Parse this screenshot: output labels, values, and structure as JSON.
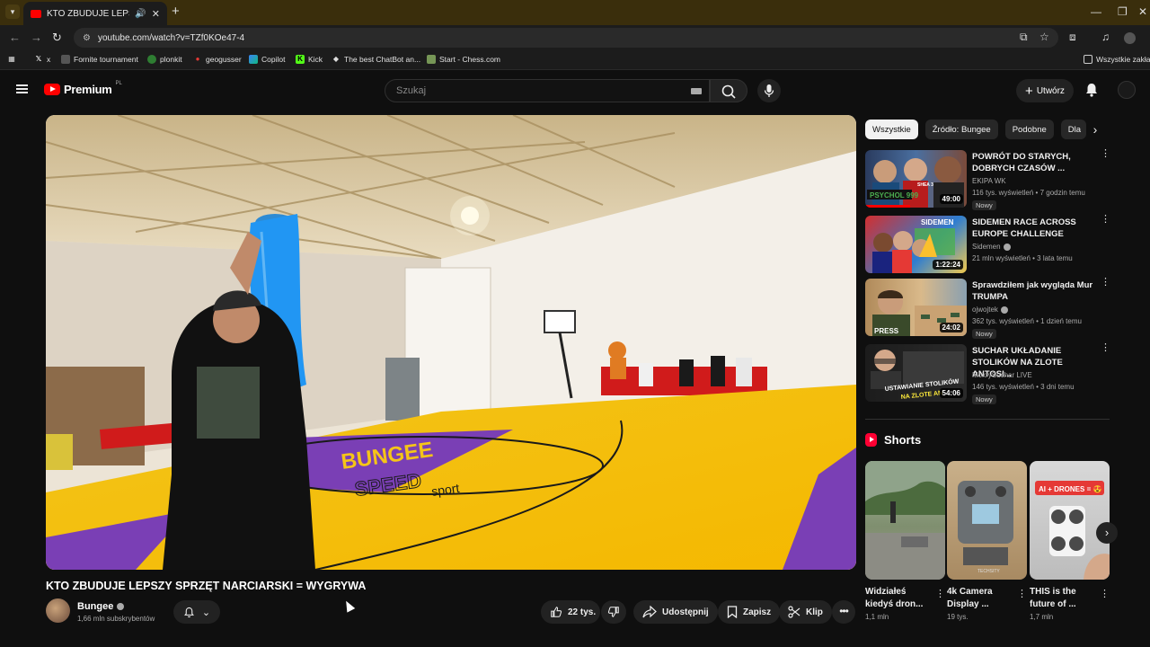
{
  "browser": {
    "tab_title": "KTO ZBUDUJE LEPSZY SPRZ",
    "url": "youtube.com/watch?v=TZf0KOe47-4",
    "bookmarks": [
      "x",
      "Fornite tournament",
      "plonkit",
      "geogusser",
      "Copilot",
      "Kick",
      "The best ChatBot an...",
      "Start - Chess.com"
    ],
    "all_bookmarks": "Wszystkie zakład"
  },
  "masthead": {
    "logo_text": "Premium",
    "country": "PL",
    "search_placeholder": "Szukaj",
    "create_label": "Utwórz"
  },
  "video": {
    "title": "KTO ZBUDUJE LEPSZY SPRZĘT NARCIARSKI = WYGRYWA",
    "channel": "Bungee",
    "subscribers": "1,66 mln subskrybentów",
    "likes": "22 tys.",
    "share_label": "Udostępnij",
    "save_label": "Zapisz",
    "clip_label": "Klip",
    "court_text_1": "BUNGEE",
    "court_text_2": "SPEED",
    "court_text_3": "sport"
  },
  "sidebar": {
    "chips": [
      "Wszystkie",
      "Źródło: Bungee",
      "Podobne",
      "Dla"
    ],
    "recommendations": [
      {
        "title": "POWRÓT DO STARYCH, DOBRYCH CZASÓW ...",
        "channel": "EKIPA WK",
        "meta": "116 tys. wyświetleń • 7 godzin temu",
        "badge": "Nowy",
        "duration": "49:00",
        "thumb_text": "PSYCHOL 999",
        "thumb_text2": "SHEA 3"
      },
      {
        "title": "SIDEMEN RACE ACROSS EUROPE CHALLENGE",
        "channel": "Sidemen",
        "meta": "21 mln wyświetleń • 3 lata temu",
        "badge": "",
        "duration": "1:22:24",
        "thumb_text": "SIDEMEN"
      },
      {
        "title": "Sprawdziłem jak wygląda Mur TRUMPA",
        "channel": "ojwojtek",
        "meta": "362 tys. wyświetleń • 1 dzień temu",
        "badge": "Nowy",
        "duration": "24:02",
        "thumb_text": "PRESS"
      },
      {
        "title": "SUCHAR UKŁADANIE STOLIKÓW NA ZLOTE ANTOSI...",
        "channel": "MokrySuchar LIVE",
        "meta": "146 tys. wyświetleń • 3 dni temu",
        "badge": "Nowy",
        "duration": "54:06",
        "thumb_text": "USTAWIANIE STOLIKÓW",
        "thumb_text2": "NA ZLOTE AN"
      }
    ],
    "shorts_heading": "Shorts",
    "shorts": [
      {
        "title": "Widziałeś kiedyś dron...",
        "views": "1,1 mln"
      },
      {
        "title": "4k Camera Display ...",
        "views": "19 tys.",
        "thumb_text": "TECHSITY"
      },
      {
        "title": "THIS is the future of ...",
        "views": "1,7 mln",
        "thumb_text": "AI + DRONES = 😍"
      }
    ]
  }
}
